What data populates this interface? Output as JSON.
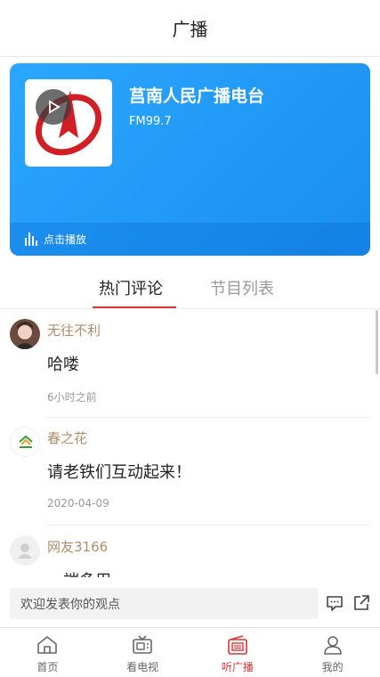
{
  "header": {
    "title": "广播"
  },
  "station": {
    "name": "莒南人民广播电台",
    "frequency": "FM99.7",
    "play_label": "点击播放"
  },
  "tabs": [
    {
      "label": "热门评论",
      "active": true
    },
    {
      "label": "节目列表",
      "active": false
    }
  ],
  "comments": [
    {
      "user": "无往不利",
      "text": "哈喽",
      "time": "6小时之前"
    },
    {
      "user": "春之花",
      "text": "请老铁们互动起来！",
      "time": "2020-04-09"
    },
    {
      "user": "网友3166",
      "text": "一端多用",
      "time": ""
    }
  ],
  "input": {
    "placeholder": "欢迎发表你的观点"
  },
  "nav": [
    {
      "label": "首页",
      "icon": "home-icon",
      "active": false
    },
    {
      "label": "看电视",
      "icon": "tv-icon",
      "active": false
    },
    {
      "label": "听广播",
      "icon": "radio-icon",
      "active": true
    },
    {
      "label": "我的",
      "icon": "user-icon",
      "active": false
    }
  ],
  "colors": {
    "accent": "#d93636",
    "card": "#1f98f5",
    "username": "#b08d6b"
  }
}
